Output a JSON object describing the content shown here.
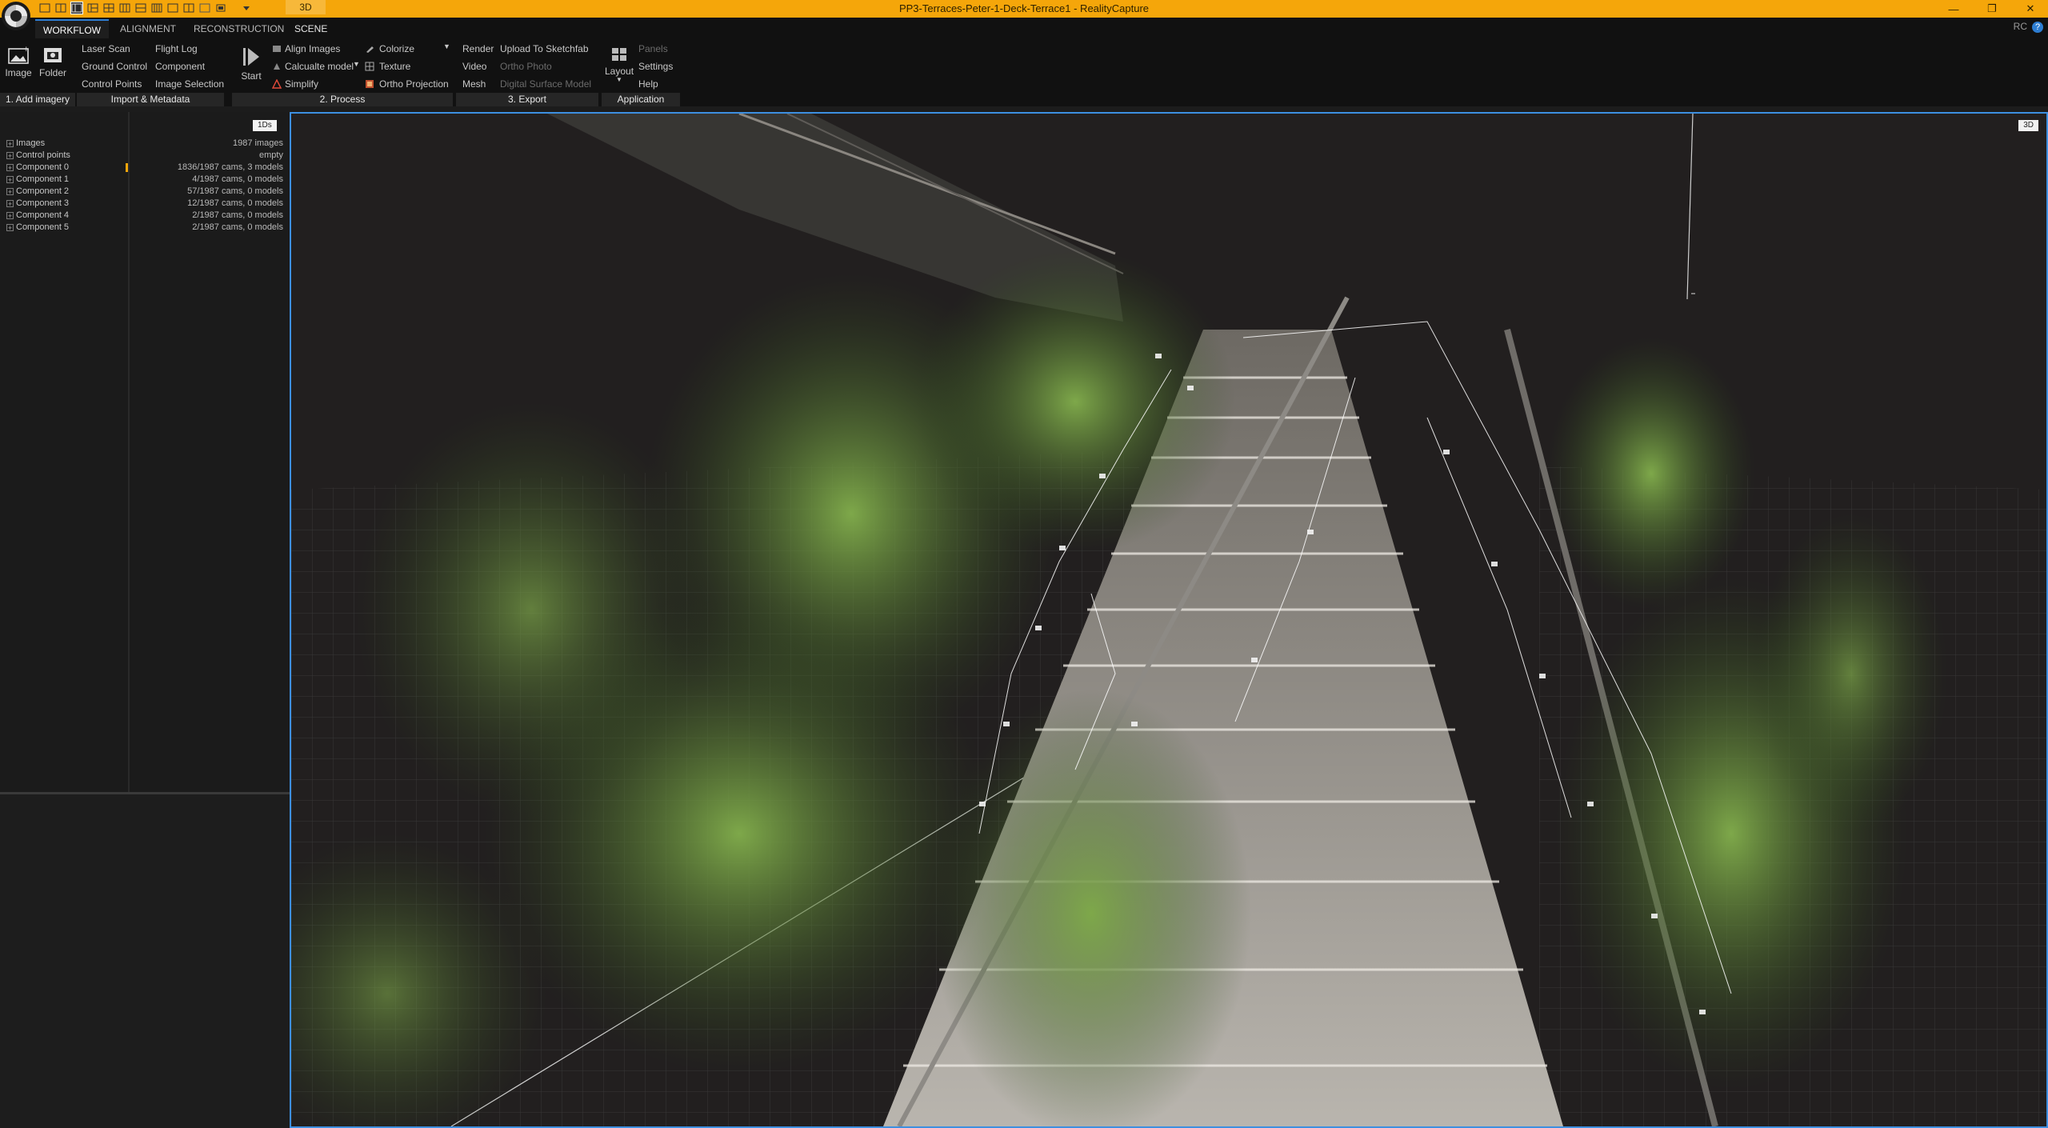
{
  "window": {
    "title": "PP3-Terraces-Peter-1-Deck-Terrace1 - RealityCapture",
    "mode_tab": "3D",
    "brand_short": "RC",
    "help_glyph": "?"
  },
  "colors": {
    "titlebar": "#f5a60a",
    "active_view_border": "#3d8fe0",
    "background": "#1c1c1c"
  },
  "ribbon_tabs": [
    {
      "label": "WORKFLOW",
      "active": true
    },
    {
      "label": "ALIGNMENT",
      "active": false
    },
    {
      "label": "RECONSTRUCTION",
      "active": false
    },
    {
      "label": "SCENE",
      "active": false
    }
  ],
  "ribbon": {
    "add_imagery": {
      "footer": "1. Add imagery",
      "image_label": "Image",
      "folder_label": "Folder"
    },
    "import": {
      "footer": "Import & Metadata",
      "col1": [
        "Laser Scan",
        "Ground Control",
        "Control Points"
      ],
      "col2": [
        "Flight Log",
        "Component",
        "Image Selection"
      ]
    },
    "process": {
      "footer": "2. Process",
      "start_label": "Start",
      "col1": [
        "Align Images",
        "Calcualte model",
        "Simplify"
      ],
      "col2": [
        "Colorize",
        "Texture",
        "Ortho Projection"
      ]
    },
    "export": {
      "footer": "3. Export",
      "col1": [
        "Render",
        "Video",
        "Mesh"
      ],
      "col2": [
        "Upload To Sketchfab",
        "Ortho Photo",
        "Digital Surface Model"
      ]
    },
    "application": {
      "footer": "Application",
      "layout_label": "Layout",
      "col": [
        "Panels",
        "Settings",
        "Help"
      ]
    }
  },
  "left_panel": {
    "view_badge": "1Ds",
    "tree": [
      {
        "label": "Images",
        "value": "1987 images"
      },
      {
        "label": "Control points",
        "value": "empty"
      },
      {
        "label": "Component 0",
        "value": "1836/1987 cams, 3 models"
      },
      {
        "label": "Component 1",
        "value": "4/1987 cams, 0 models"
      },
      {
        "label": "Component 2",
        "value": "57/1987 cams, 0 models"
      },
      {
        "label": "Component 3",
        "value": "12/1987 cams, 0 models"
      },
      {
        "label": "Component 4",
        "value": "2/1987 cams, 0 models"
      },
      {
        "label": "Component 5",
        "value": "2/1987 cams, 0 models"
      }
    ]
  },
  "viewport": {
    "view_badge": "3D"
  }
}
